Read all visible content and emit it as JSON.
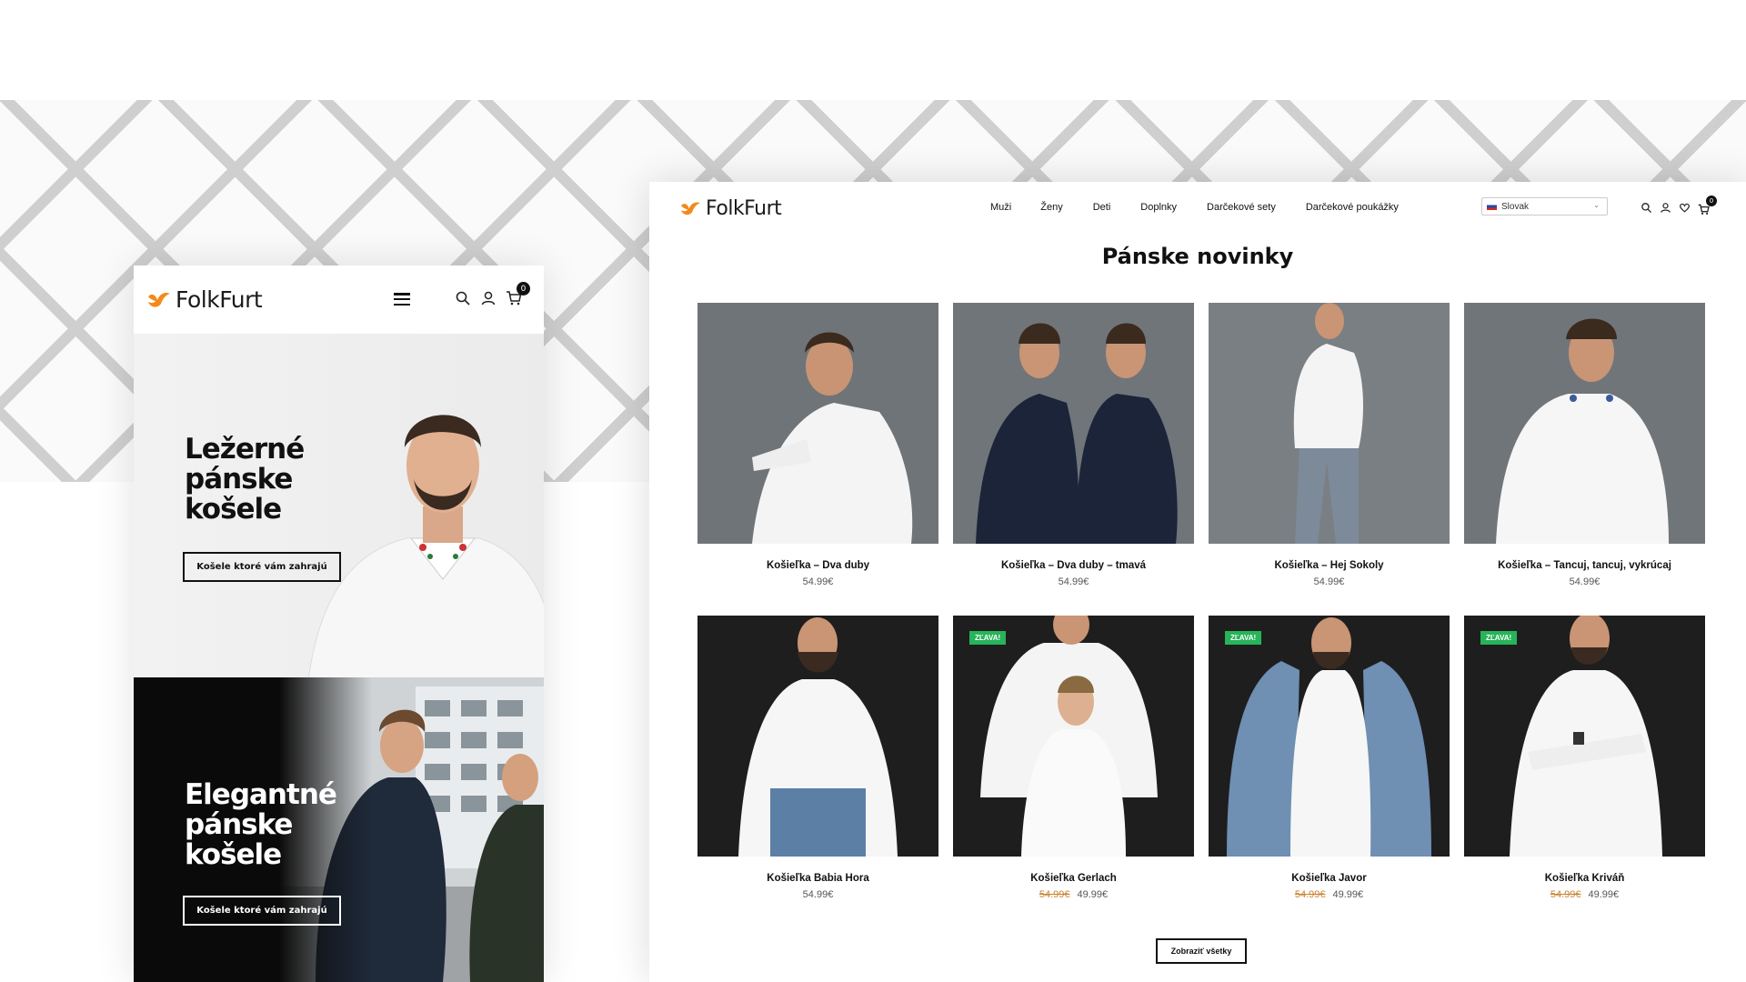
{
  "brand": {
    "name": "FolkFurt",
    "accent": "#f28a1a"
  },
  "mobile": {
    "cart_count": "0",
    "hero1": {
      "title": "Ležerné\npánske\nkošele",
      "button": "Košele ktoré vám zahrajú"
    },
    "hero2": {
      "title": "Elegantné\npánske\nkošele",
      "button": "Košele ktoré vám zahrajú"
    }
  },
  "desktop": {
    "nav": [
      "Muži",
      "Ženy",
      "Deti",
      "Doplnky",
      "Darčekové sety",
      "Darčekové poukážky"
    ],
    "language": "Slovak",
    "cart_count": "0",
    "section_title": "Pánske novinky",
    "products": [
      {
        "name": "Košieľka – Dva duby",
        "price": "54.99€",
        "old_price": "",
        "sale": "",
        "style": "light"
      },
      {
        "name": "Košieľka – Dva duby – tmavá",
        "price": "54.99€",
        "old_price": "",
        "sale": "",
        "style": "light"
      },
      {
        "name": "Košieľka – Hej Sokoly",
        "price": "54.99€",
        "old_price": "",
        "sale": "",
        "style": "light"
      },
      {
        "name": "Košieľka – Tancuj, tancuj, vykrúcaj",
        "price": "54.99€",
        "old_price": "",
        "sale": "",
        "style": "light"
      },
      {
        "name": "Košieľka Babia Hora",
        "price": "54.99€",
        "old_price": "",
        "sale": "",
        "style": "dark"
      },
      {
        "name": "Košieľka Gerlach",
        "price": "49.99€",
        "old_price": "54.99€",
        "sale": "ZĽAVA!",
        "style": "dark"
      },
      {
        "name": "Košieľka Javor",
        "price": "49.99€",
        "old_price": "54.99€",
        "sale": "ZĽAVA!",
        "style": "dark"
      },
      {
        "name": "Košieľka Kriváň",
        "price": "49.99€",
        "old_price": "54.99€",
        "sale": "ZĽAVA!",
        "style": "dark"
      }
    ],
    "show_all": "Zobraziť všetky"
  }
}
